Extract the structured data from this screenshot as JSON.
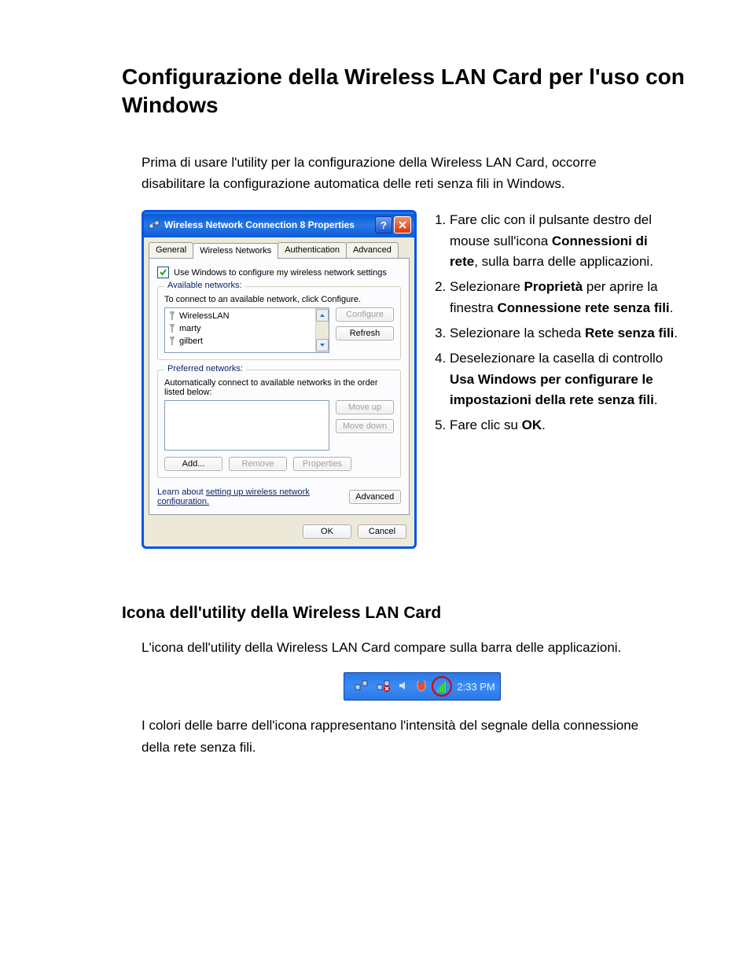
{
  "heading": "Configurazione della Wireless LAN Card per l'uso con Windows",
  "intro": "Prima di usare l'utility per la configurazione della Wireless LAN Card, occorre disabilitare la configurazione automatica delle reti senza fili in Windows.",
  "dialog": {
    "title": "Wireless Network Connection 8 Properties",
    "tabs": {
      "general": "General",
      "wireless": "Wireless Networks",
      "auth": "Authentication",
      "adv": "Advanced"
    },
    "checkbox_label": "Use Windows to configure my wireless network settings",
    "available": {
      "title": "Available networks:",
      "hint": "To connect to an available network, click Configure.",
      "items": [
        "WirelessLAN",
        "marty",
        "gilbert"
      ],
      "configure": "Configure",
      "refresh": "Refresh"
    },
    "preferred": {
      "title": "Preferred networks:",
      "hint": "Automatically connect to available networks in the order listed below:",
      "moveup": "Move up",
      "movedown": "Move down",
      "add": "Add...",
      "remove": "Remove",
      "props": "Properties"
    },
    "learn_prefix": "Learn about ",
    "learn_link": "setting up wireless network configuration.",
    "advanced_btn": "Advanced",
    "ok": "OK",
    "cancel": "Cancel"
  },
  "steps": {
    "s1a": "Fare clic con il pulsante destro del mouse sull'icona ",
    "s1b": "Connessioni di rete",
    "s1c": ", sulla barra delle applicazioni.",
    "s2a": "Selezionare ",
    "s2b": "Proprietà",
    "s2c": " per aprire la finestra ",
    "s2d": "Connessione rete senza fili",
    "s2e": ".",
    "s3a": "Selezionare la scheda ",
    "s3b": "Rete senza fili",
    "s3c": ".",
    "s4a": "Deselezionare la casella di controllo ",
    "s4b": "Usa Windows per configurare le impostazioni della rete senza fili",
    "s4c": ".",
    "s5a": "Fare clic su ",
    "s5b": "OK",
    "s5c": "."
  },
  "heading2": "Icona dell'utility della Wireless LAN Card",
  "p2a": "L'icona dell'utility della Wireless LAN Card compare sulla barra delle applicazioni.",
  "tray_time": "2:33 PM",
  "p2b": "I colori delle barre dell'icona rappresentano l'intensità del segnale della connessione della rete senza fili."
}
